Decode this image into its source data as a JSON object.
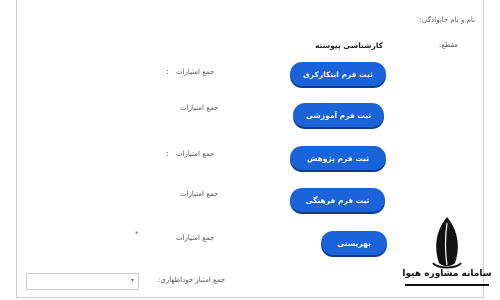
{
  "form": {
    "name_label": "نام و نام خانوادگی:",
    "degree_label": "مقطع:",
    "degree_value": "کارشناسی پیوسته",
    "score_label": "جمع امتیازات",
    "colon": ":",
    "required_mark": "*",
    "self_score_label": "جمع امتیاز خوداظهاری:",
    "self_score_select_value": ""
  },
  "buttons": {
    "innovation": "ثبت فرم ابتکارکری",
    "education": "ثبت فرم آموزشی",
    "research": "ثبت فرم پژوهش",
    "cultural": "ثبت فرم فرهنگی",
    "update": "بهزیستی"
  },
  "logo": {
    "text": "سامانه مشاوره هیوا"
  },
  "colors": {
    "button_bg": "#1a63d8",
    "button_text": "#ffffff"
  }
}
